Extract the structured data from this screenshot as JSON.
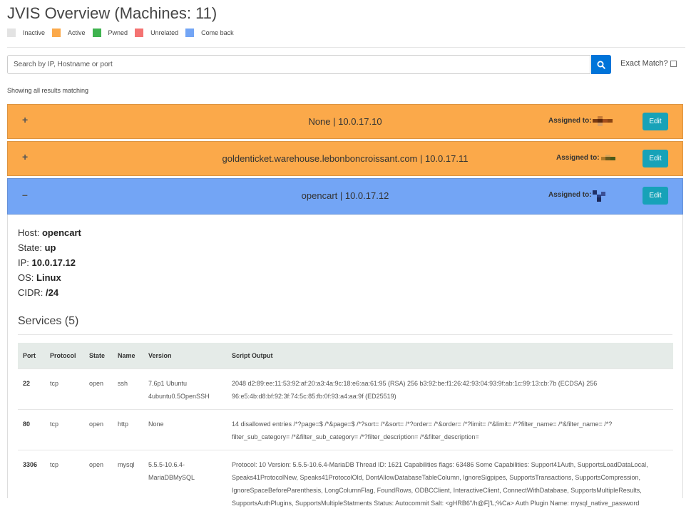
{
  "header": {
    "title": "JVIS Overview (Machines: 11)"
  },
  "legend": [
    {
      "label": "Inactive",
      "color": "#e3e3e3"
    },
    {
      "label": "Active",
      "color": "#fba94a"
    },
    {
      "label": "Pwned",
      "color": "#3fb34f"
    },
    {
      "label": "Unrelated",
      "color": "#f47372"
    },
    {
      "label": "Come back",
      "color": "#73a5f5"
    }
  ],
  "search": {
    "placeholder": "Search by IP, Hostname or port",
    "value": "",
    "exact_label": "Exact Match?",
    "button_icon": "search-icon"
  },
  "status": {
    "showing": "Showing all results matching"
  },
  "machines": [
    {
      "toggle": "+",
      "title": "None | 10.0.17.10",
      "assigned_label": "Assigned to:",
      "edit": "Edit",
      "color": "#fba94a"
    },
    {
      "toggle": "+",
      "title": "goldenticket.warehouse.lebonboncroissant.com | 10.0.17.11",
      "assigned_label": "Assigned to:",
      "edit": "Edit",
      "color": "#fba94a"
    },
    {
      "toggle": "–",
      "title": "opencart | 10.0.17.12",
      "assigned_label": "Assigned to:",
      "edit": "Edit",
      "color": "#73a5f5"
    }
  ],
  "detail": {
    "host_label": "Host:",
    "host": "opencart",
    "state_label": "State:",
    "state": "up",
    "ip_label": "IP:",
    "ip": "10.0.17.12",
    "os_label": "OS:",
    "os": "Linux",
    "cidr_label": "CIDR:",
    "cidr": "/24",
    "services_title": "Services (5)"
  },
  "services": {
    "columns": [
      "Port",
      "Protocol",
      "State",
      "Name",
      "Version",
      "Script Output"
    ],
    "rows": [
      {
        "port": "22",
        "protocol": "tcp",
        "state": "open",
        "name": "ssh",
        "version": "7.6p1 Ubuntu 4ubuntu0.5OpenSSH",
        "output": "2048 d2:89:ee:11:53:92:af:20:a3:4a:9c:18:e6:aa:61:95 (RSA) 256 b3:92:be:f1:26:42:93:04:93:9f:ab:1c:99:13:cb:7b (ECDSA) 256 96:e5:4b:d8:bf:92:3f:74:5c:85:fb:0f:93:a4:aa:9f (ED25519)"
      },
      {
        "port": "80",
        "protocol": "tcp",
        "state": "open",
        "name": "http",
        "version": "None",
        "output": "14 disallowed entries /*?page=$ /*&page=$ /*?sort= /*&sort= /*?order= /*&order= /*?limit= /*&limit= /*?filter_name= /*&filter_name= /*?filter_sub_category= /*&filter_sub_category= /*?filter_description= /*&filter_description="
      },
      {
        "port": "3306",
        "protocol": "tcp",
        "state": "open",
        "name": "mysql",
        "version": "5.5.5-10.6.4-MariaDBMySQL",
        "output": "Protocol: 10 Version: 5.5.5-10.6.4-MariaDB Thread ID: 1621 Capabilities flags: 63486 Some Capabilities: Support41Auth, SupportsLoadDataLocal, Speaks41ProtocolNew, Speaks41ProtocolOld, DontAllowDatabaseTableColumn, IgnoreSigpipes, SupportsTransactions, SupportsCompression, IgnoreSpaceBeforeParenthesis, LongColumnFlag, FoundRows, ODBCClient, InteractiveClient, ConnectWithDatabase, SupportsMultipleResults, SupportsAuthPlugins, SupportsMultipleStatments Status: Autocommit Salt: <gHRB6\"/h@F]'L;%Ca> Auth Plugin Name: mysql_native_password"
      }
    ]
  }
}
